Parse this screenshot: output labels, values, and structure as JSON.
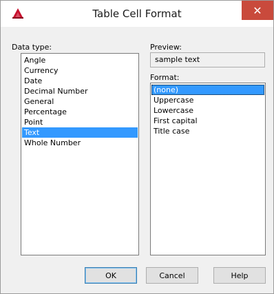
{
  "window": {
    "title": "Table Cell Format",
    "close_glyph": "✕",
    "app_icon": "autocad-logo-icon",
    "accent_color": "#c94a3c"
  },
  "data_type": {
    "label": "Data type:",
    "items": [
      "Angle",
      "Currency",
      "Date",
      "Decimal Number",
      "General",
      "Percentage",
      "Point",
      "Text",
      "Whole Number"
    ],
    "selected": "Text"
  },
  "preview": {
    "label": "Preview:",
    "value": "sample text"
  },
  "format": {
    "label": "Format:",
    "items": [
      "(none)",
      "Uppercase",
      "Lowercase",
      "First capital",
      "Title case"
    ],
    "selected": "(none)"
  },
  "buttons": {
    "ok": "OK",
    "cancel": "Cancel",
    "help": "Help"
  },
  "selection_color": "#3399ff"
}
